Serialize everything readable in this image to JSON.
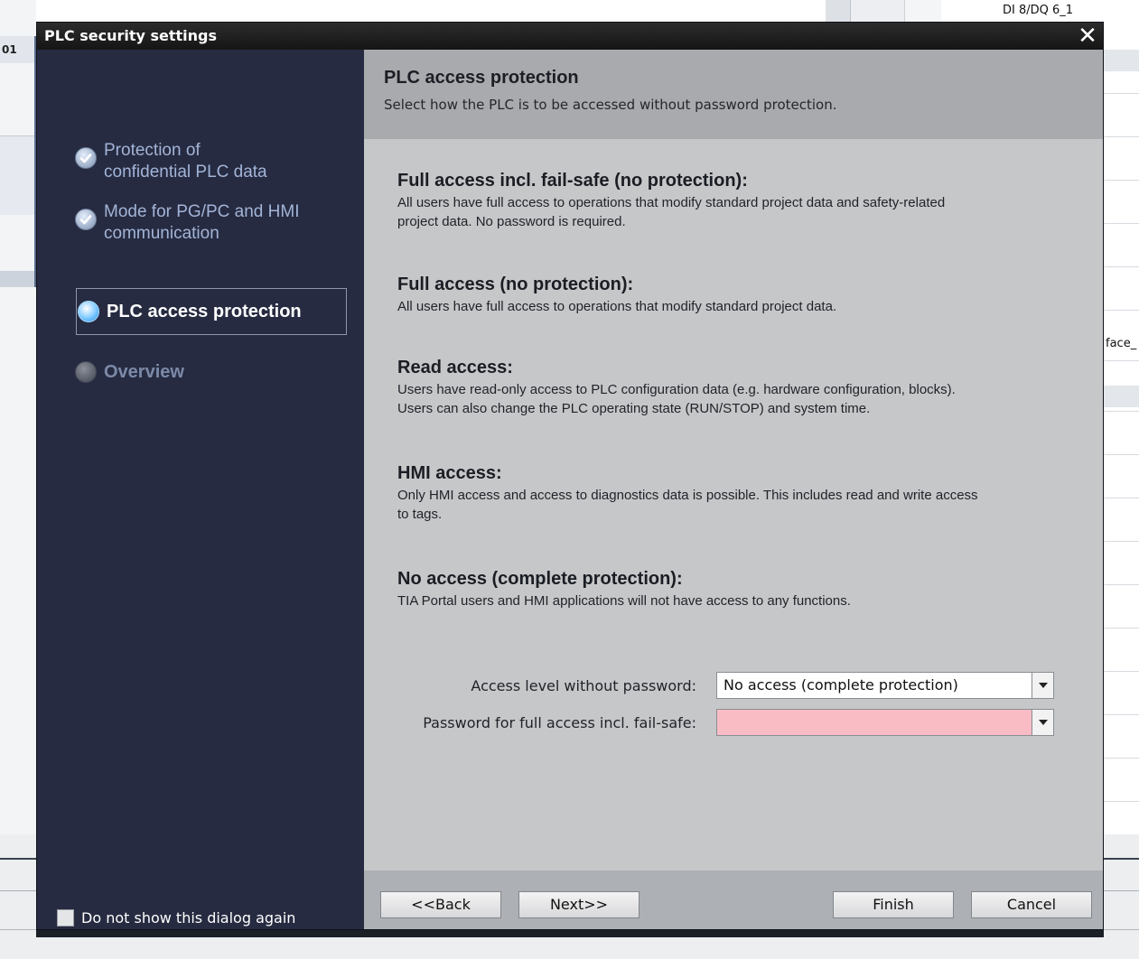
{
  "background": {
    "left_text": "01",
    "device_label": "DI 8/DQ 6_1",
    "right_fragment": "face_"
  },
  "dialog": {
    "title": "PLC security settings",
    "close_glyph": "✕"
  },
  "sidebar": {
    "items": [
      {
        "label_line1": "Protection of",
        "label_line2": "confidential PLC data",
        "state": "done"
      },
      {
        "label_line1": "Mode for PG/PC and HMI",
        "label_line2": "communication",
        "state": "done"
      },
      {
        "label": "PLC access protection",
        "state": "active"
      },
      {
        "label": "Overview",
        "state": "pending"
      }
    ],
    "dont_show_label": "Do not show this dialog again"
  },
  "header": {
    "title": "PLC access protection",
    "subtitle": "Select how the PLC is to be accessed without password protection."
  },
  "options": [
    {
      "title": "Full access incl. fail-safe (no protection):",
      "desc_line1": "All users have full access to operations that modify standard project data and safety-related",
      "desc_line2": "project data. No password is required."
    },
    {
      "title": "Full access (no protection):",
      "desc_line1": "All users have full access to operations that modify standard project data."
    },
    {
      "title": "Read access:",
      "desc_line1": "Users have read-only access to PLC configuration data (e.g. hardware configuration, blocks).",
      "desc_line2": "Users can also change the PLC operating state (RUN/STOP) and system time."
    },
    {
      "title": "HMI access:",
      "desc_line1": "Only HMI access and access to diagnostics data is possible. This includes read and write access",
      "desc_line2": "to tags."
    },
    {
      "title": "No access (complete protection):",
      "desc_line1": "TIA Portal users and HMI applications will not have access to any functions."
    }
  ],
  "fields": {
    "access_level": {
      "label": "Access level without password:",
      "value": "No access (complete protection)"
    },
    "password": {
      "label": "Password for full access incl. fail-safe:",
      "value": ""
    }
  },
  "buttons": {
    "back": "<<Back",
    "next": "Next>>",
    "finish": "Finish",
    "cancel": "Cancel"
  },
  "colors": {
    "dialog_bg": "#262b41",
    "content_bg": "#c6c7c9",
    "header_bg": "#a9aaad",
    "password_required": "#f9bcc5",
    "active_step": "#1f8ad8"
  }
}
